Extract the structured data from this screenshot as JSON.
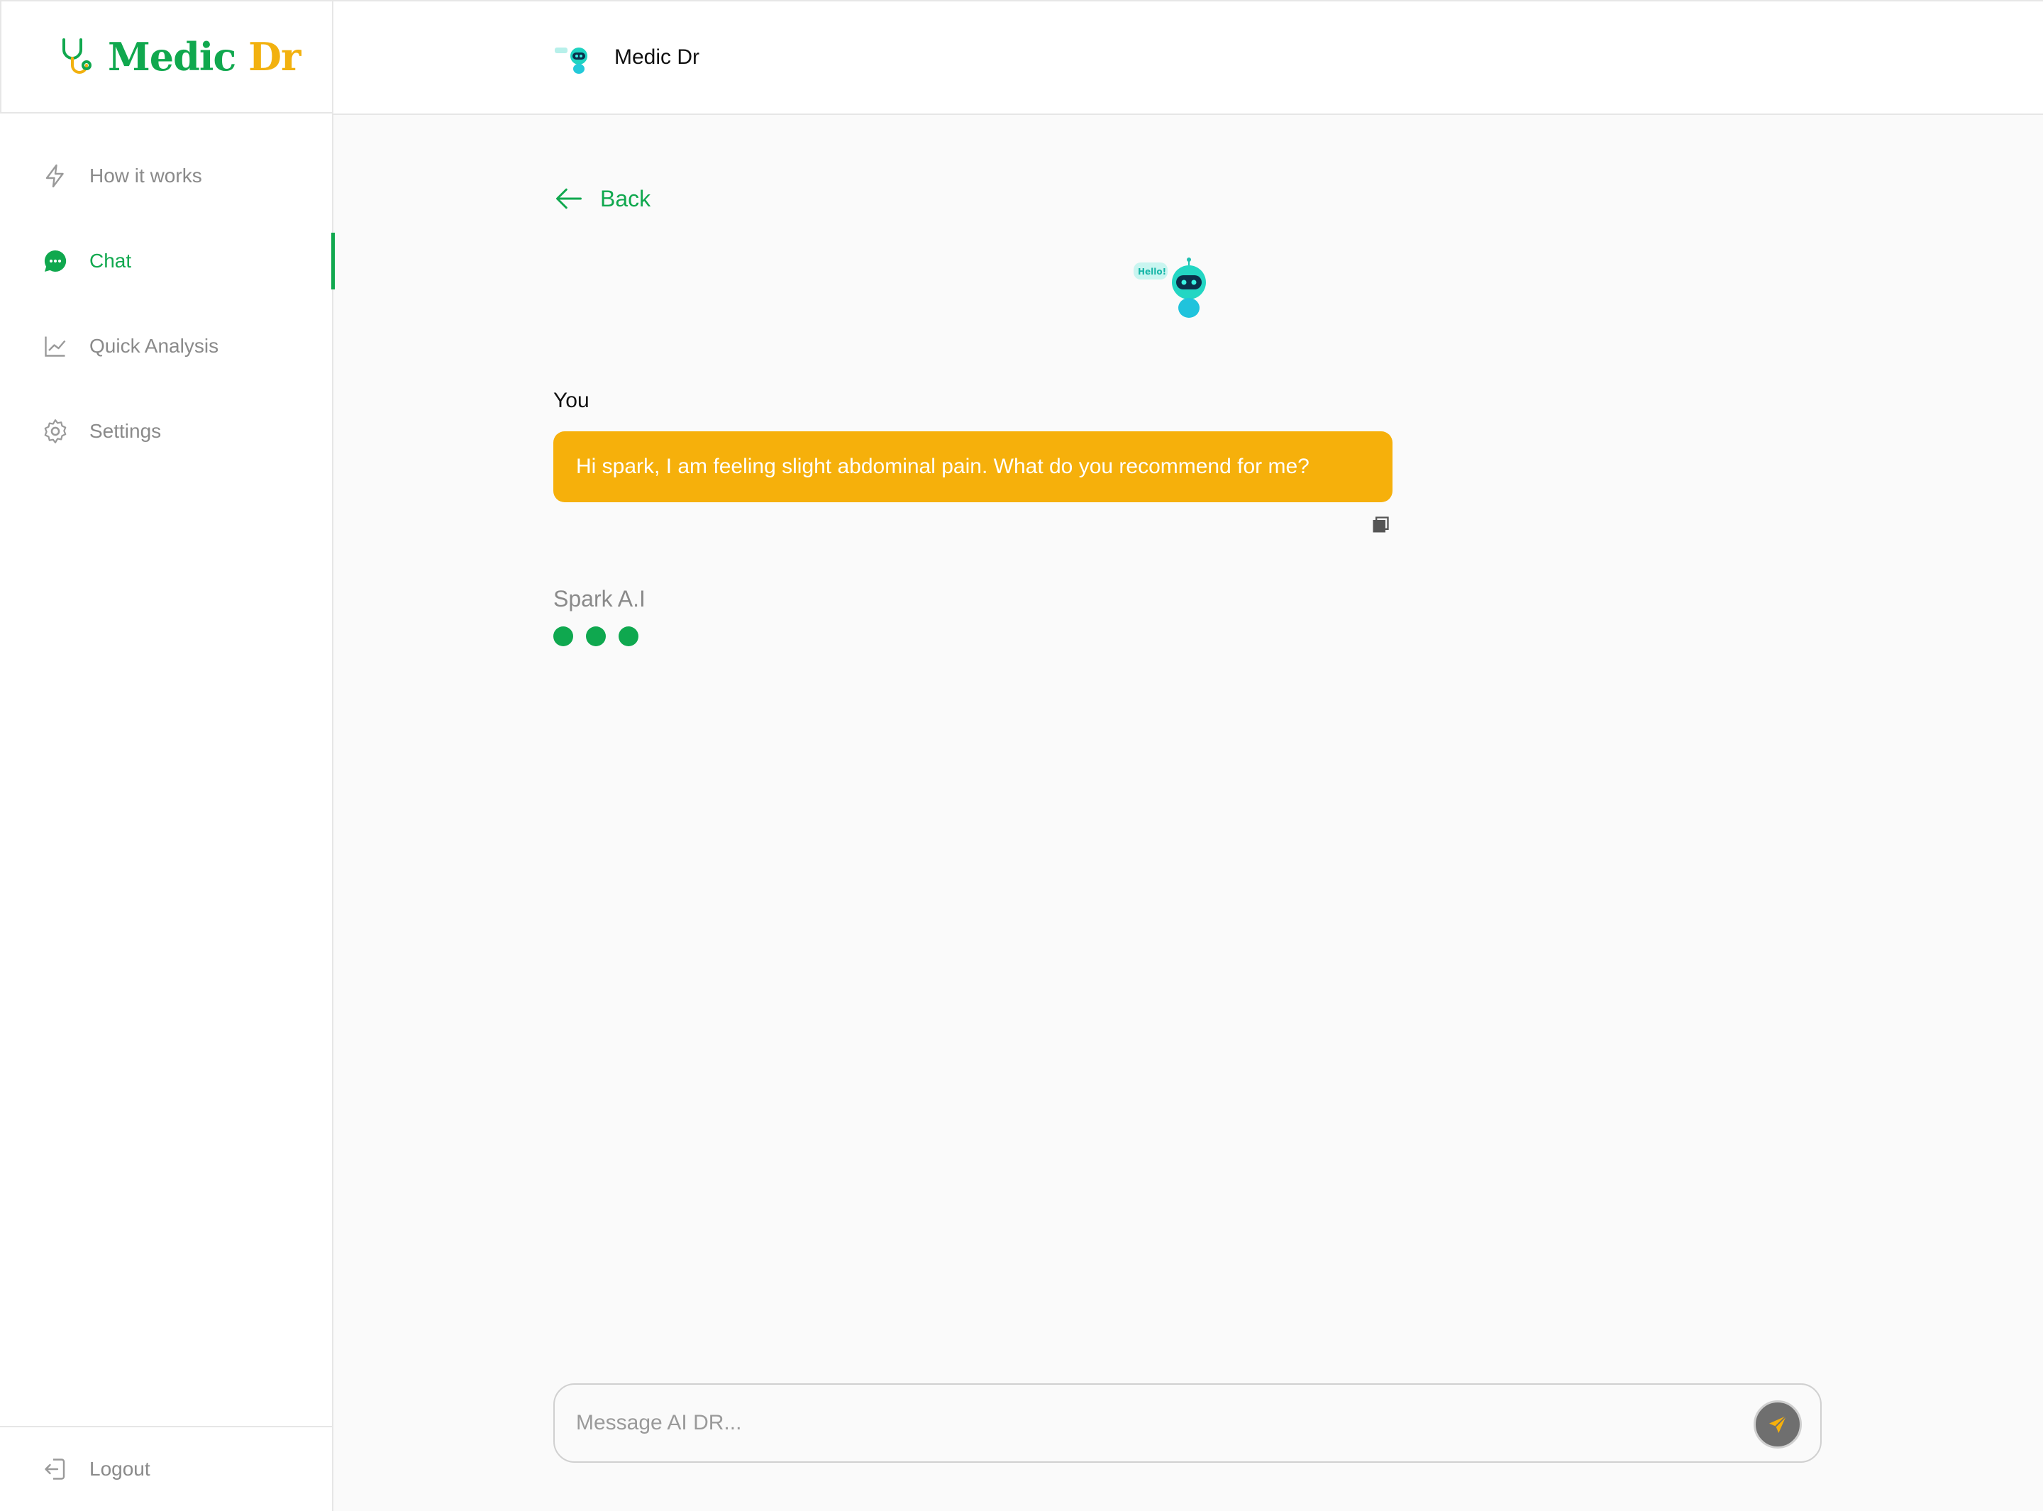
{
  "brand": {
    "name_part1": "Medic",
    "name_part2": "Dr"
  },
  "sidebar": {
    "items": [
      {
        "label": "How it works",
        "icon": "lightning-icon",
        "active": false
      },
      {
        "label": "Chat",
        "icon": "chat-bubble-icon",
        "active": true
      },
      {
        "label": "Quick Analysis",
        "icon": "line-chart-icon",
        "active": false
      },
      {
        "label": "Settings",
        "icon": "gear-icon",
        "active": false
      }
    ],
    "logout_label": "Logout"
  },
  "header": {
    "title": "Medic Dr"
  },
  "main": {
    "back_label": "Back",
    "bot_greeting": "Hello!",
    "messages": [
      {
        "sender": "You",
        "text": "Hi spark, I am feeling slight abdominal pain. What do you recommend for me?"
      }
    ],
    "assistant_name": "Spark A.I"
  },
  "composer": {
    "placeholder": "Message AI DR...",
    "value": ""
  },
  "colors": {
    "accent_green": "#10a84e",
    "accent_yellow": "#f6b00b",
    "send_button": "#6f6f6f"
  }
}
